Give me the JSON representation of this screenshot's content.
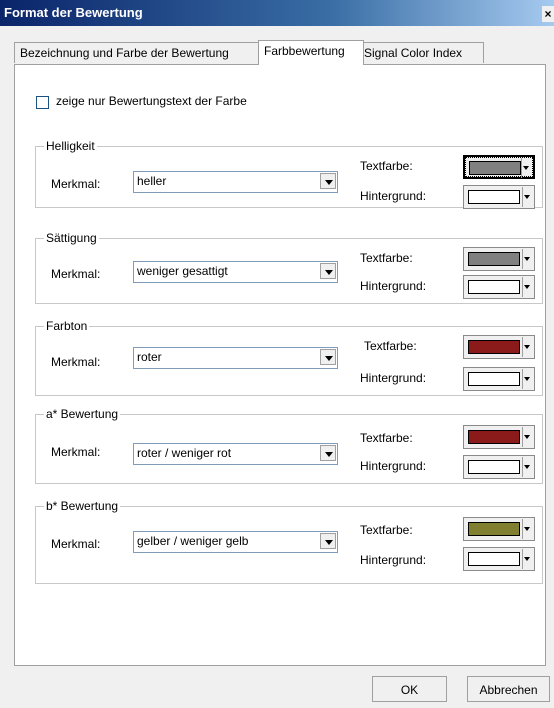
{
  "window": {
    "title": "Format der Bewertung",
    "close": "×"
  },
  "tabs": [
    {
      "label": "Bezeichnung und Farbe der Bewertung",
      "active": false
    },
    {
      "label": "Farbbewertung",
      "active": true
    },
    {
      "label": "Signal Color Index",
      "active": false
    }
  ],
  "checkbox": {
    "label": "zeige nur Bewertungstext der Farbe",
    "checked": false
  },
  "groups": [
    {
      "legend": "Helligkeit",
      "merkmal_label": "Merkmal:",
      "merkmal_value": "heller",
      "textfarbe_label": "Textfarbe:",
      "hintergrund_label": "Hintergrund:",
      "text_color": "#808080",
      "bg_color": "#ffffff"
    },
    {
      "legend": "Sättigung",
      "merkmal_label": "Merkmal:",
      "merkmal_value": "weniger gesattigt",
      "textfarbe_label": "Textfarbe:",
      "hintergrund_label": "Hintergrund:",
      "text_color": "#808080",
      "bg_color": "#ffffff"
    },
    {
      "legend": "Farbton",
      "merkmal_label": "Merkmal:",
      "merkmal_value": "roter",
      "textfarbe_label": "Textfarbe:",
      "hintergrund_label": "Hintergrund:",
      "text_color": "#8b1a1a",
      "bg_color": "#ffffff"
    },
    {
      "legend": "a* Bewertung",
      "merkmal_label": "Merkmal:",
      "merkmal_value": "roter / weniger rot",
      "textfarbe_label": "Textfarbe:",
      "hintergrund_label": "Hintergrund:",
      "text_color": "#8b1a1a",
      "bg_color": "#ffffff"
    },
    {
      "legend": "b* Bewertung",
      "merkmal_label": "Merkmal:",
      "merkmal_value": "gelber / weniger gelb",
      "textfarbe_label": "Textfarbe:",
      "hintergrund_label": "Hintergrund:",
      "text_color": "#808030",
      "bg_color": "#ffffff"
    }
  ],
  "buttons": {
    "ok": "OK",
    "cancel": "Abbrechen"
  }
}
